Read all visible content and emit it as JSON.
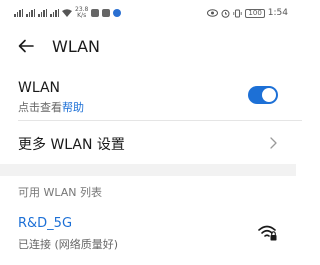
{
  "status_bar": {
    "speed": "23.8\nK/s",
    "battery": "100",
    "time": "1:54"
  },
  "header": {
    "title": "WLAN"
  },
  "wlan": {
    "label": "WLAN",
    "subtitle_prefix": "点击查看",
    "subtitle_link": "帮助",
    "enabled": true
  },
  "more_settings": {
    "label": "更多 WLAN 设置"
  },
  "available": {
    "section_title": "可用 WLAN 列表",
    "networks": [
      {
        "name": "R&D_5G",
        "status": "已连接 (网络质量好)",
        "secured": true
      }
    ]
  },
  "colors": {
    "accent": "#1d70d6",
    "text": "#1a1a1a",
    "secondary": "#666666",
    "section_gap": "#f2f2f2"
  }
}
